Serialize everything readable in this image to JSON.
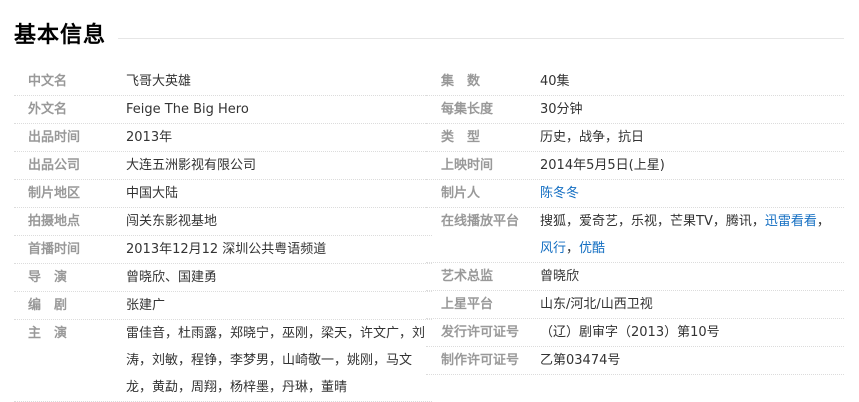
{
  "heading": "基本信息",
  "left": [
    {
      "label": "中文名",
      "value": "飞哥大英雄"
    },
    {
      "label": "外文名",
      "value": "Feige The Big Hero"
    },
    {
      "label": "出品时间",
      "value": "2013年"
    },
    {
      "label": "出品公司",
      "value": "大连五洲影视有限公司"
    },
    {
      "label": "制片地区",
      "value": "中国大陆"
    },
    {
      "label": "拍摄地点",
      "value": "闯关东影视基地"
    },
    {
      "label": "首播时间",
      "value": "2013年12月12  深圳公共粤语频道"
    },
    {
      "label": "导　演",
      "value": "曾晓欣、国建勇"
    },
    {
      "label": "编　剧",
      "value": "张建广"
    },
    {
      "label": "主　演",
      "value": "雷佳音，杜雨露，郑晓宁，巫刚，梁天，许文广，刘涛，刘敏，程铮，李梦男，山崎敬一，姚刚，马文龙，黄勐，周翔，杨梓墨，丹琳，董晴"
    }
  ],
  "right": [
    {
      "label": "集　数",
      "value": "40集"
    },
    {
      "label": "每集长度",
      "value": "30分钟"
    },
    {
      "label": "类　型",
      "value": "历史，战争，抗日"
    },
    {
      "label": "上映时间",
      "value": "2014年5月5日(上星)"
    },
    {
      "label": "制片人",
      "value": "陈冬冬"
    },
    {
      "label": "在线播放平台",
      "value_line1": "搜狐，爱奇艺，乐视，芒果TV，腾讯，",
      "value_link1": "迅雷看看",
      "value_sep1": "，",
      "value_link2": "风行",
      "value_sep2": "，",
      "value_link3": "优酷"
    },
    {
      "label": "艺术总监",
      "value": "曾晓欣"
    },
    {
      "label": "上星平台",
      "value": "山东/河北/山西卫视"
    },
    {
      "label": "发行许可证号",
      "value": "（辽）剧审字（2013）第10号"
    },
    {
      "label": "制作许可证号",
      "value": "乙第03474号"
    }
  ]
}
